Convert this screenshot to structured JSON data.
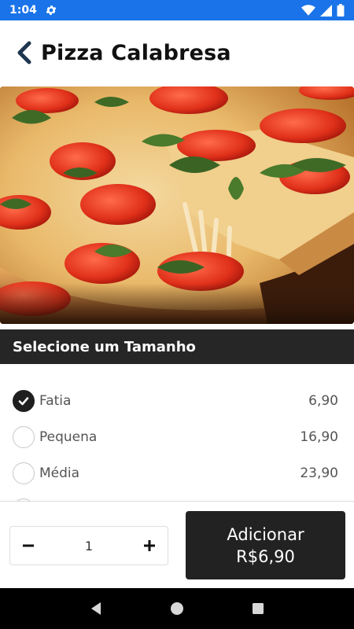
{
  "status_bar": {
    "time": "1:04",
    "icons": [
      "gear-icon",
      "wifi-icon",
      "signal-icon",
      "battery-icon"
    ],
    "background": "#1a73e8"
  },
  "header": {
    "back_icon": "chevron-left-icon",
    "title": "Pizza Calabresa"
  },
  "hero": {
    "image": "pizza-photo"
  },
  "size_section": {
    "title": "Selecione um Tamanho",
    "options": [
      {
        "label": "Fatia",
        "price": "6,90",
        "selected": true
      },
      {
        "label": "Pequena",
        "price": "16,90",
        "selected": false
      },
      {
        "label": "Média",
        "price": "23,90",
        "selected": false
      }
    ]
  },
  "quantity": {
    "decrement_icon": "minus-icon",
    "value": "1",
    "increment_icon": "plus-icon"
  },
  "add_button": {
    "label": "Adicionar",
    "price": "R$6,90",
    "background": "#222222"
  },
  "nav_bar": {
    "icons": [
      "back-triangle-icon",
      "home-circle-icon",
      "recents-square-icon"
    ]
  }
}
